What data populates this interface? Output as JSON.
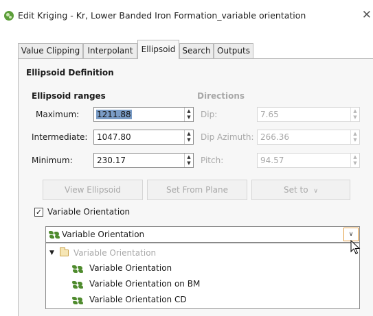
{
  "window": {
    "title": "Edit Kriging - Kr, Lower Banded Iron Formation_variable orientation",
    "close_glyph": "✕",
    "app_icon": "leapfrog-app-icon"
  },
  "tabs": [
    {
      "label": "Value Clipping",
      "active": false
    },
    {
      "label": "Interpolant",
      "active": false
    },
    {
      "label": "Ellipsoid",
      "active": true
    },
    {
      "label": "Search",
      "active": false
    },
    {
      "label": "Outputs",
      "active": false
    }
  ],
  "ellipsoid": {
    "section_title": "Ellipsoid Definition",
    "ranges_title": "Ellipsoid ranges",
    "directions_title": "Directions",
    "maximum": {
      "label": "Maximum:",
      "value": "1211.88"
    },
    "intermediate": {
      "label": "Intermediate:",
      "value": "1047.80"
    },
    "minimum": {
      "label": "Minimum:",
      "value": "230.17"
    },
    "dip": {
      "label": "Dip:",
      "value": "7.65"
    },
    "dip_azimuth": {
      "label": "Dip Azimuth:",
      "value": "266.36"
    },
    "pitch": {
      "label": "Pitch:",
      "value": "94.57"
    },
    "buttons": {
      "view_ellipsoid": "View Ellipsoid",
      "set_from_plane": "Set From Plane",
      "set_to": "Set to"
    }
  },
  "variable_orientation": {
    "checkbox_label": "Variable Orientation",
    "checked": true,
    "selected": "Variable Orientation",
    "dropdown": {
      "folder": "Variable Orientation",
      "items": [
        "Variable Orientation",
        "Variable Orientation on BM",
        "Variable Orientation CD"
      ]
    }
  },
  "colors": {
    "accent_focus": "#e39b3c",
    "selection": "#7a9cc6",
    "vo_icon_green": "#4f8b2e"
  }
}
